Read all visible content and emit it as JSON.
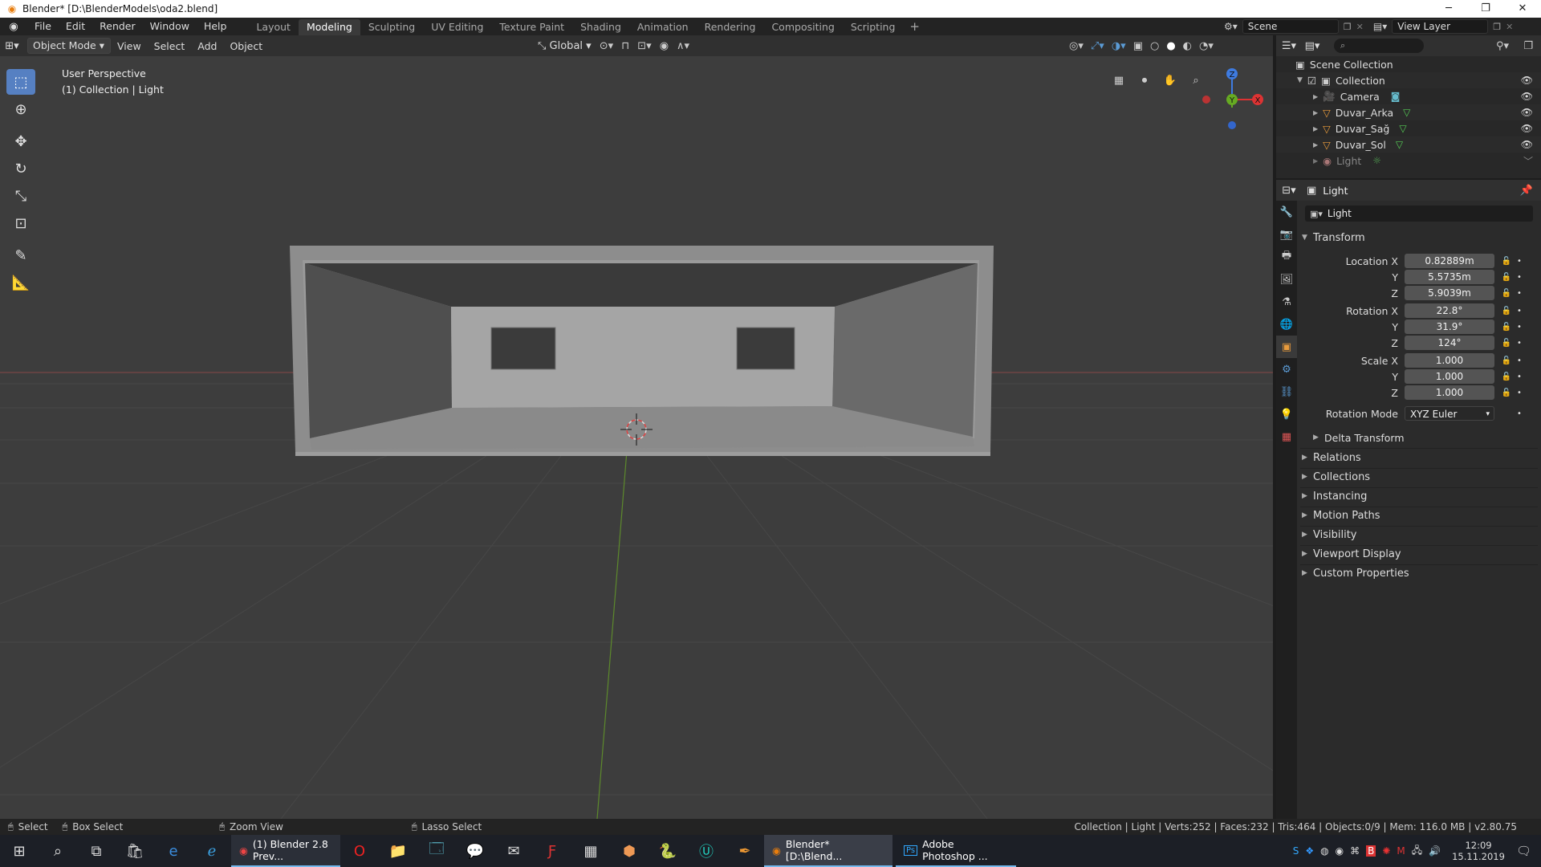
{
  "window": {
    "title": "Blender* [D:\\BlenderModels\\oda2.blend]"
  },
  "menu": [
    "File",
    "Edit",
    "Render",
    "Window",
    "Help"
  ],
  "workspaces": [
    "Layout",
    "Modeling",
    "Sculpting",
    "UV Editing",
    "Texture Paint",
    "Shading",
    "Animation",
    "Rendering",
    "Compositing",
    "Scripting"
  ],
  "active_workspace": "Modeling",
  "scene": {
    "name": "Scene",
    "view_layer": "View Layer"
  },
  "viewport_header": {
    "mode": "Object Mode",
    "menus": [
      "View",
      "Select",
      "Add",
      "Object"
    ],
    "orientation": "Global"
  },
  "viewport": {
    "perspective": "User Perspective",
    "collection_info": "(1) Collection | Light"
  },
  "gizmo": {
    "x": "X",
    "y": "Y",
    "z": "Z"
  },
  "outliner": {
    "root": "Scene Collection",
    "collection": "Collection",
    "items": [
      "Camera",
      "Duvar_Arka",
      "Duvar_Sağ",
      "Duvar_Sol",
      "Light"
    ]
  },
  "properties": {
    "object_name": "Light",
    "datablock_name": "Light",
    "transform_title": "Transform",
    "location": {
      "label": "Location X",
      "x": "0.82889m",
      "y": "5.5735m",
      "z": "5.9039m"
    },
    "rotation": {
      "label": "Rotation X",
      "x": "22.8°",
      "y": "31.9°",
      "z": "124°"
    },
    "scale": {
      "label": "Scale X",
      "x": "1.000",
      "y": "1.000",
      "z": "1.000"
    },
    "axis_y": "Y",
    "axis_z": "Z",
    "rotation_mode_label": "Rotation Mode",
    "rotation_mode": "XYZ Euler",
    "delta": "Delta Transform",
    "panels": [
      "Relations",
      "Collections",
      "Instancing",
      "Motion Paths",
      "Visibility",
      "Viewport Display",
      "Custom Properties"
    ]
  },
  "statusbar": {
    "select": "Select",
    "box_select": "Box Select",
    "zoom_view": "Zoom View",
    "lasso_select": "Lasso Select",
    "stats": "Collection | Light | Verts:252 | Faces:232 | Tris:464 | Objects:0/9 | Mem: 116.0 MB | v2.80.75"
  },
  "taskbar": {
    "chrome": "(1) Blender 2.8 Prev...",
    "blender": "Blender* [D:\\Blend...",
    "photoshop": "Adobe Photoshop ...",
    "ps_badge": "Ps",
    "time": "12:09",
    "date": "15.11.2019"
  }
}
